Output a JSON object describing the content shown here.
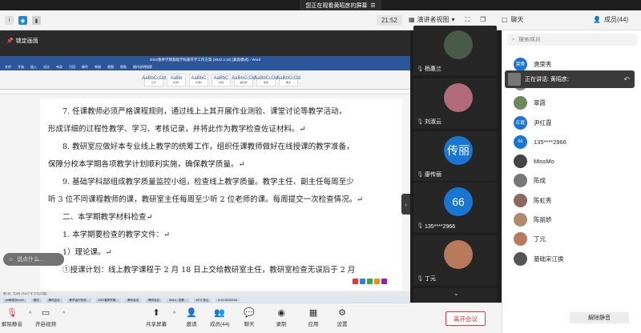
{
  "share_banner": {
    "text": "您正在观看黄昭彦的屏幕"
  },
  "topbar": {
    "time": "21:52",
    "view_label": "演讲者视图",
    "chat_label": "聊天",
    "members_label": "成员(44)"
  },
  "share": {
    "lock_label": "锁定画面",
    "chat_placeholder": "说点什么...",
    "word_title": "2022春季学期基础学科部开学工作方案 (2022.2.16) [兼容模式] - Word",
    "ribbon_tabs": [
      "文件",
      "开始",
      "插入",
      "设计",
      "布局",
      "引用",
      "邮件",
      "审阅",
      "视图",
      "帮助",
      "操作说明搜索"
    ],
    "styles": [
      {
        "sample": "AaBbCcDd",
        "name": "正文"
      },
      {
        "sample": "AaBb",
        "name": "标题1"
      },
      {
        "sample": "AaBbC",
        "name": "标题2"
      },
      {
        "sample": "AaBbC",
        "name": "标题"
      },
      {
        "sample": "AaBbCcDd",
        "name": "副标题"
      },
      {
        "sample": "AaBbCcDd",
        "name": "强调"
      },
      {
        "sample": "AaBbCcDd",
        "name": "要点"
      }
    ],
    "doc_lines": [
      "7. 任课教师必须严格课程规则，通过线上上其开展作业测验、课堂讨论等教学活动，",
      "形成详细的过程性教学、学习、考核记录，并将此作为教学检查佐证材料。↵",
      "8. 教研室应做好本专业线上教学的统筹工作，组织任课教师做好在线授课的教学准备，",
      "保障分校本学期各项教学计划顺利实施，确保教学质量。↵",
      "9. 基础学科部组成教学质量监控小组，检查线上教学质量。教学主任、副主任每周至少",
      "听 3 位不同课程教师的课，教研室主任每周至少听 2 位老师的课。每周提交一次检查情况。↵",
      "二、本学期教学材料检查↵",
      "1. 本学期要检查的教学文件：↵",
      "1）理论课。↵",
      "①授课计划：线上教学课程于 2 月 18 日上交给教研室主任，教研室检查无误后于 2 月"
    ],
    "status_text": "第1页，共5页    2243个字    中文(中国)",
    "taskbar_items": [
      "p#网络办excel",
      "微信",
      "腾讯会议",
      "教学运行检查...",
      "2022春季学期...",
      "腾讯会议",
      "腾讯会议",
      "Word - 查看...",
      "23°C 多云",
      "9:14 2022/2/18"
    ]
  },
  "tiles": [
    {
      "name": "杨惠兰",
      "avatar": "",
      "color": "#4a5a4a"
    },
    {
      "name": "刘淑云",
      "avatar": "",
      "color": "#b06a7a"
    },
    {
      "name": "廖传丽",
      "avatar": "传丽",
      "color": "#1976d2"
    },
    {
      "name": "135****2966",
      "avatar": "66",
      "color": "#1976d2"
    },
    {
      "name": "丁元",
      "avatar": "",
      "color": "#b87a5a"
    }
  ],
  "speaking": {
    "text": "正在讲话: 黄昭彦;"
  },
  "search": {
    "placeholder": "搜索成员"
  },
  "members": [
    {
      "name": "唐荣秀",
      "avatar": "荣秀",
      "color": "#1976d2"
    },
    {
      "name": "王芳",
      "avatar": "",
      "color": "#888"
    },
    {
      "name": "翠霞",
      "avatar": "",
      "color": "#6a8a5a"
    },
    {
      "name": "尹红霞",
      "avatar": "红霞",
      "color": "#1976d2"
    },
    {
      "name": "135****2966",
      "avatar": "66",
      "color": "#1976d2"
    },
    {
      "name": "MissMo",
      "avatar": "",
      "color": "#444"
    },
    {
      "name": "陈成",
      "avatar": "",
      "color": "#777"
    },
    {
      "name": "陈虹秀",
      "avatar": "",
      "color": "#8a6a5a"
    },
    {
      "name": "陈丽娇",
      "avatar": "",
      "color": "#b08a6a"
    },
    {
      "name": "丁元",
      "avatar": "",
      "color": "#b87a5a"
    },
    {
      "name": "基础宋江换",
      "avatar": "",
      "color": "#555"
    }
  ],
  "mute_all": "解除静音",
  "bottombar": {
    "unmute": "解除静音",
    "video": "开启视频",
    "share": "共享屏幕",
    "invite": "邀请",
    "members": "成员(44)",
    "chat": "聊天",
    "record": "录制",
    "apps": "应用",
    "settings": "设置",
    "leave": "离开会议"
  }
}
